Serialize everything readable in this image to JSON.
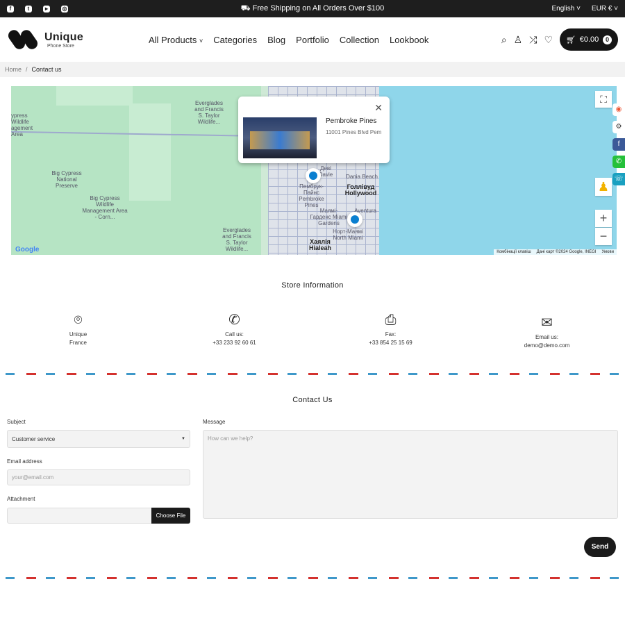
{
  "topbar": {
    "social": [
      "facebook-icon",
      "twitter-icon",
      "youtube-icon",
      "instagram-icon"
    ],
    "promo": "Free Shipping on All Orders Over $100",
    "language": "English",
    "currency": "EUR €"
  },
  "header": {
    "logo_name": "Unique",
    "logo_sub": "Phone Store",
    "nav": [
      "All Products",
      "Categories",
      "Blog",
      "Portfolio",
      "Collection",
      "Lookbook"
    ],
    "cart_total": "€0.00",
    "cart_count": "0"
  },
  "breadcrumb": {
    "home": "Home",
    "current": "Contact us"
  },
  "map": {
    "popup_title": "Pembroke Pines",
    "popup_address": "11001 Pines Blvd Pem",
    "labels": {
      "everglades1": "Everglades and Francis S. Taylor Wildlife...",
      "everglades2": "Everglades and Francis S. Taylor Wildlife...",
      "cypress": "Big Cypress National Preserve",
      "cypress_wma": "Big Cypress Wildlife Management Area - Corn...",
      "cypress_top": "ypress Wildlife agement Area",
      "davie": "Девi Davie",
      "pembroke": "Пембрук-Пайнс Pembroke Pines",
      "hollywood": "Голлівуд Hollywood",
      "dania": "Dania Beach",
      "gardens": "Маямі-Гарденс Miami Gardens",
      "aventura": "Aventura",
      "north_miami": "Норт-Маямі North Miami",
      "hialeah": "Хаялія Hialeah"
    },
    "google": "Google",
    "attribution": [
      "Комбінації клавіш",
      "Дані карт ©2024 Google, INEGI",
      "Умови"
    ]
  },
  "colors": {
    "accent": "#1b1b1b",
    "map_water": "#8fd6ea",
    "stripe_blue": "#3e98c9",
    "stripe_red": "#d3322e"
  },
  "store": {
    "title": "Store Information",
    "items": [
      {
        "icon": "location-pin-icon",
        "line1": "Unique",
        "line2": "France"
      },
      {
        "icon": "phone-icon",
        "line1": "Call us:",
        "line2": "+33 233 92 60 61"
      },
      {
        "icon": "printer-icon",
        "line1": "Fax:",
        "line2": "+33 854 25 15 69"
      },
      {
        "icon": "envelope-icon",
        "line1": "Email us:",
        "line2": "demo@demo.com"
      }
    ]
  },
  "contact": {
    "title": "Contact Us",
    "subject_label": "Subject",
    "subject_value": "Customer service",
    "email_label": "Email address",
    "email_placeholder": "your@email.com",
    "attachment_label": "Attachment",
    "choose_file": "Choose File",
    "message_label": "Message",
    "message_placeholder": "How can we help?",
    "send": "Send"
  }
}
